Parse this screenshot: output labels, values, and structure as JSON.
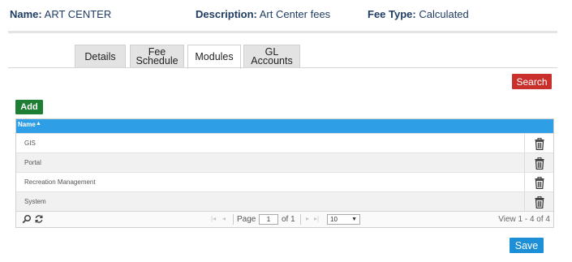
{
  "header": {
    "name_label": "Name:",
    "name_value": "ART CENTER",
    "description_label": "Description:",
    "description_value": "Art Center fees",
    "fee_type_label": "Fee Type:",
    "fee_type_value": "Calculated"
  },
  "tabs": [
    {
      "label_line1": "Details",
      "label_line2": ""
    },
    {
      "label_line1": "Fee",
      "label_line2": "Schedule"
    },
    {
      "label_line1": "Modules",
      "label_line2": "",
      "active": true
    },
    {
      "label_line1": "GL Accounts",
      "label_line2": ""
    }
  ],
  "buttons": {
    "search": "Search",
    "add": "Add",
    "save": "Save"
  },
  "grid": {
    "column_header": "Name",
    "sort_indicator": "▲",
    "rows": [
      "GIS",
      "Portal",
      "Recreation Management",
      "System"
    ],
    "row_action_icon": "trash-icon"
  },
  "pager": {
    "search_icon": "magnifier-icon",
    "refresh_icon": "refresh-icon",
    "first": "|◂",
    "prev": "◂",
    "page_label": "Page",
    "current_page": "1",
    "of_label": "of 1",
    "next": "▸",
    "last": "▸|",
    "rows_per_page": "10",
    "select_caret": "▼",
    "view_text": "View 1 - 4 of 4"
  },
  "colors": {
    "header_text": "#1f3d63",
    "grid_header": "#2e9ee6",
    "search_button": "#c9302c",
    "add_button": "#1e7e34",
    "save_button": "#1d8fd6"
  }
}
